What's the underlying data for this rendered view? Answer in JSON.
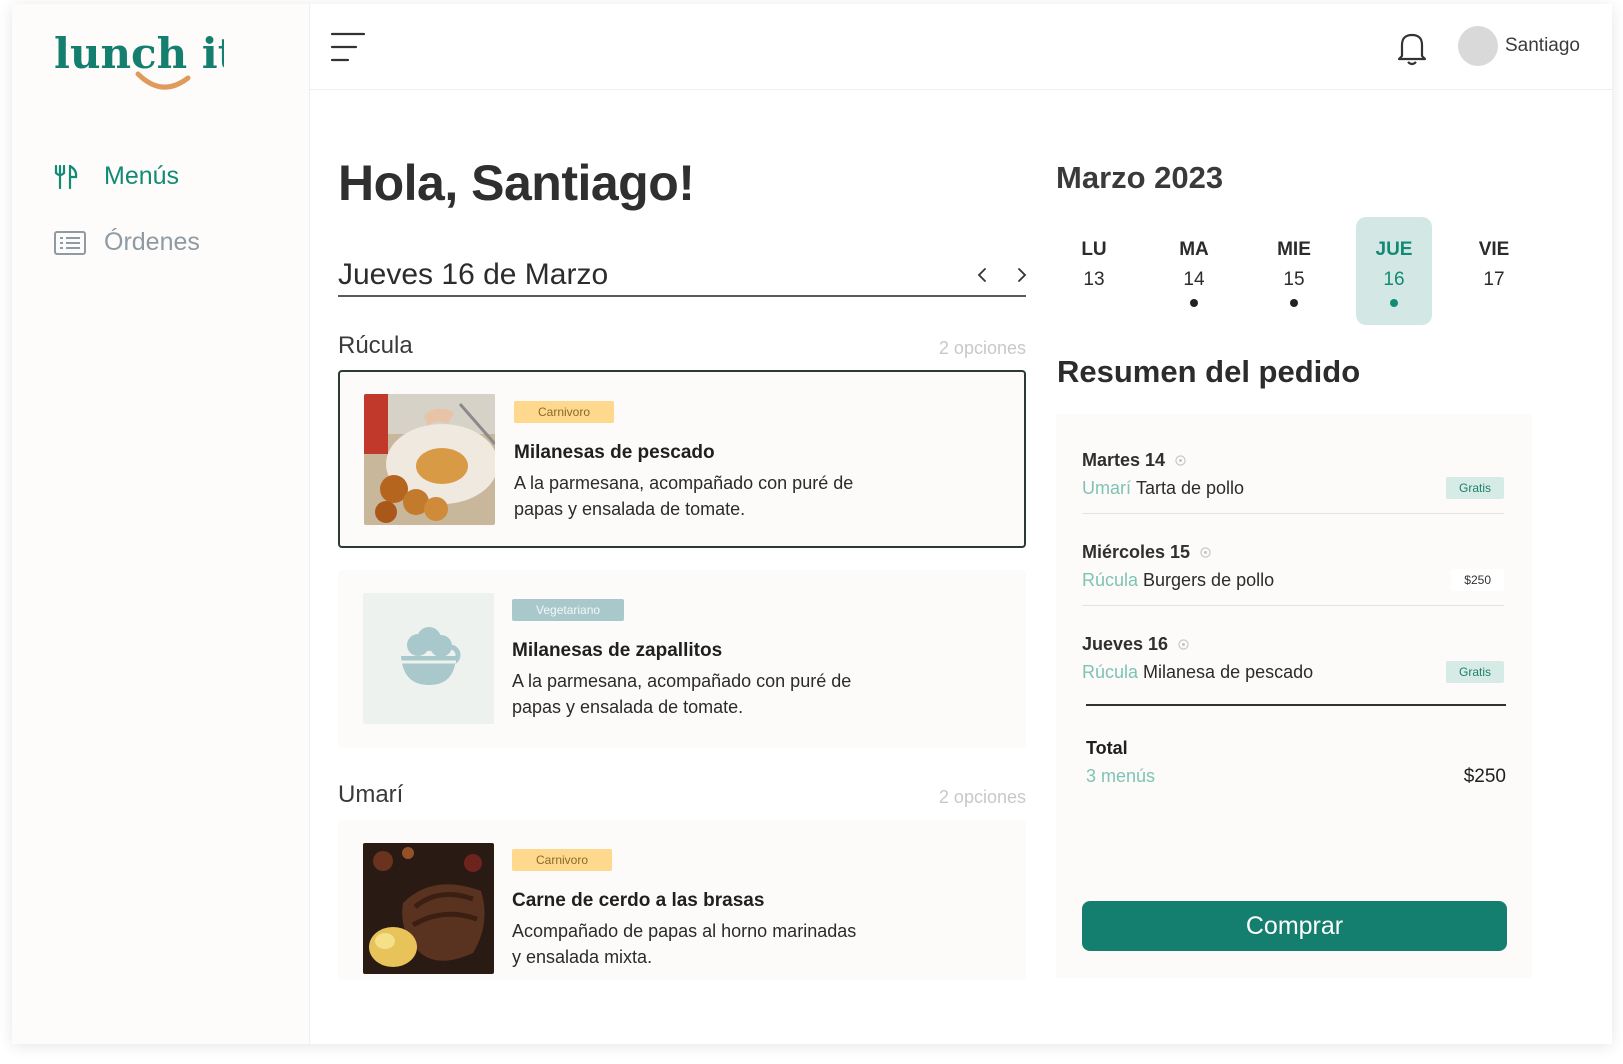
{
  "brand": {
    "logo_text": "lunch it",
    "primary_color": "#147f6f",
    "accent_color": "#e09a5b"
  },
  "sidebar": {
    "items": [
      {
        "label": "Menús",
        "icon": "utensils-icon",
        "active": true
      },
      {
        "label": "Órdenes",
        "icon": "list-icon",
        "active": false
      }
    ]
  },
  "topbar": {
    "menu_icon": "menu-icon",
    "notification_icon": "bell-icon",
    "user_name": "Santiago"
  },
  "main": {
    "greeting": "Hola, Santiago!",
    "date_title": "Jueves 16 de Marzo",
    "restaurants": [
      {
        "name": "Rúcula",
        "count": "2 opciones",
        "dishes": [
          {
            "badge": "Carnivoro",
            "name": "Milanesas de pescado",
            "desc": "A la parmesana, acompañado con puré de papas y ensalada de tomate.",
            "selected": true
          },
          {
            "badge": "Vegetariano",
            "name": "Milanesas de zapallitos",
            "desc": "A la parmesana, acompañado con puré de papas y ensalada de tomate.",
            "selected": false
          }
        ]
      },
      {
        "name": "Umarí",
        "count": "2 opciones",
        "dishes": [
          {
            "badge": "Carnivoro",
            "name": "Carne de cerdo a las brasas",
            "desc": "Acompañado de papas al horno marinadas y ensalada mixta.",
            "selected": false
          }
        ]
      }
    ]
  },
  "calendar": {
    "month": "Marzo 2023",
    "days": [
      {
        "dow": "LU",
        "num": "13",
        "has_order": false,
        "active": false
      },
      {
        "dow": "MA",
        "num": "14",
        "has_order": true,
        "active": false
      },
      {
        "dow": "MIE",
        "num": "15",
        "has_order": true,
        "active": false
      },
      {
        "dow": "JUE",
        "num": "16",
        "has_order": true,
        "active": true
      },
      {
        "dow": "VIE",
        "num": "17",
        "has_order": false,
        "active": false
      }
    ]
  },
  "summary": {
    "title": "Resumen del pedido",
    "orders": [
      {
        "day": "Martes 14",
        "restaurant": "Umarí",
        "dish": "Tarta de pollo",
        "price": "Gratis"
      },
      {
        "day": "Miércoles 15",
        "restaurant": "Rúcula",
        "dish": "Burgers de pollo",
        "price": "$250"
      },
      {
        "day": "Jueves 16",
        "restaurant": "Rúcula",
        "dish": "Milanesa de pescado",
        "price": "Gratis"
      }
    ],
    "total_label": "Total",
    "total_count": "3 menús",
    "total_amount": "$250",
    "buy_label": "Comprar"
  }
}
